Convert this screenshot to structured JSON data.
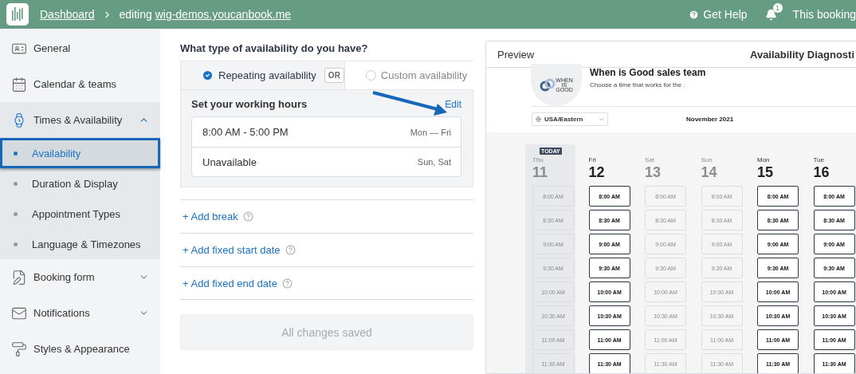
{
  "topbar": {
    "breadcrumb": "Dashboard",
    "editing": "editing",
    "site": "wig-demos.youcanbook.me",
    "help": "Get Help",
    "notification_count": "1",
    "booking": "This booking"
  },
  "sidebar": {
    "items": [
      {
        "label": "General",
        "expanded": false,
        "expandable": false
      },
      {
        "label": "Calendar & teams",
        "expanded": false,
        "expandable": false
      },
      {
        "label": "Times & Availability",
        "expanded": true,
        "expandable": true,
        "children": [
          {
            "label": "Availability",
            "selected": true
          },
          {
            "label": "Duration & Display",
            "selected": false
          },
          {
            "label": "Appointment Types",
            "selected": false
          },
          {
            "label": "Language & Timezones",
            "selected": false
          }
        ]
      },
      {
        "label": "Booking form",
        "expanded": false,
        "expandable": true
      },
      {
        "label": "Notifications",
        "expanded": false,
        "expandable": true
      },
      {
        "label": "Styles & Appearance",
        "expanded": false,
        "expandable": false
      }
    ]
  },
  "availability": {
    "question": "What type of availability do you have?",
    "options": [
      {
        "label": "Repeating availability",
        "selected": true
      },
      {
        "label": "Custom availability",
        "selected": false
      }
    ],
    "or": "OR",
    "working_hours": {
      "title": "Set your working hours",
      "edit": "Edit",
      "rows": [
        {
          "hours": "8:00 AM - 5:00 PM",
          "days": "Mon — Fri"
        },
        {
          "hours": "Unavailable",
          "days": "Sun, Sat"
        }
      ]
    },
    "links": [
      "+ Add break",
      "+ Add fixed start date",
      "+ Add fixed end date"
    ],
    "save": {
      "label": "All changes saved",
      "disabled": true
    }
  },
  "preview": {
    "title": "Preview",
    "diagnostics": "Availability Diagnosti",
    "logo_text": [
      "WHEN",
      "IS",
      "GOOD"
    ],
    "team": "When is Good sales team",
    "subtitle": "Choose a time that works for the .",
    "timezone": "USA/Eastern",
    "month": "November 2021",
    "days": [
      {
        "dow": "Thu",
        "date": "11",
        "today": true,
        "today_label": "TODAY",
        "available": false,
        "slots": [
          "8:00 AM",
          "8:30 AM",
          "9:00 AM",
          "9:30 AM",
          "10:00 AM",
          "10:30 AM",
          "11:00 AM",
          "11:30 AM"
        ]
      },
      {
        "dow": "Fri",
        "date": "12",
        "today": false,
        "available": true,
        "slots": [
          "8:00 AM",
          "8:30 AM",
          "9:00 AM",
          "9:30 AM",
          "10:00 AM",
          "10:30 AM",
          "11:00 AM",
          "11:30 AM"
        ]
      },
      {
        "dow": "Sat",
        "date": "13",
        "today": false,
        "available": false,
        "slots": [
          "8:00 AM",
          "8:30 AM",
          "9:00 AM",
          "9:30 AM",
          "10:00 AM",
          "10:30 AM",
          "11:00 AM",
          "11:30 AM"
        ]
      },
      {
        "dow": "Sun",
        "date": "14",
        "today": false,
        "available": false,
        "slots": [
          "8:00 AM",
          "8:30 AM",
          "9:00 AM",
          "9:30 AM",
          "10:00 AM",
          "10:30 AM",
          "11:00 AM",
          "11:30 AM"
        ]
      },
      {
        "dow": "Mon",
        "date": "15",
        "today": false,
        "available": true,
        "slots": [
          "8:00 AM",
          "8:30 AM",
          "9:00 AM",
          "9:30 AM",
          "10:00 AM",
          "10:30 AM",
          "11:00 AM",
          "11:30 AM"
        ]
      },
      {
        "dow": "Tue",
        "date": "16",
        "today": false,
        "available": true,
        "slots": [
          "8:00 AM",
          "8:30 AM",
          "9:00 AM",
          "9:30 AM",
          "10:00 AM",
          "10:30 AM",
          "11:00 AM",
          "11:30 AM"
        ]
      }
    ]
  }
}
